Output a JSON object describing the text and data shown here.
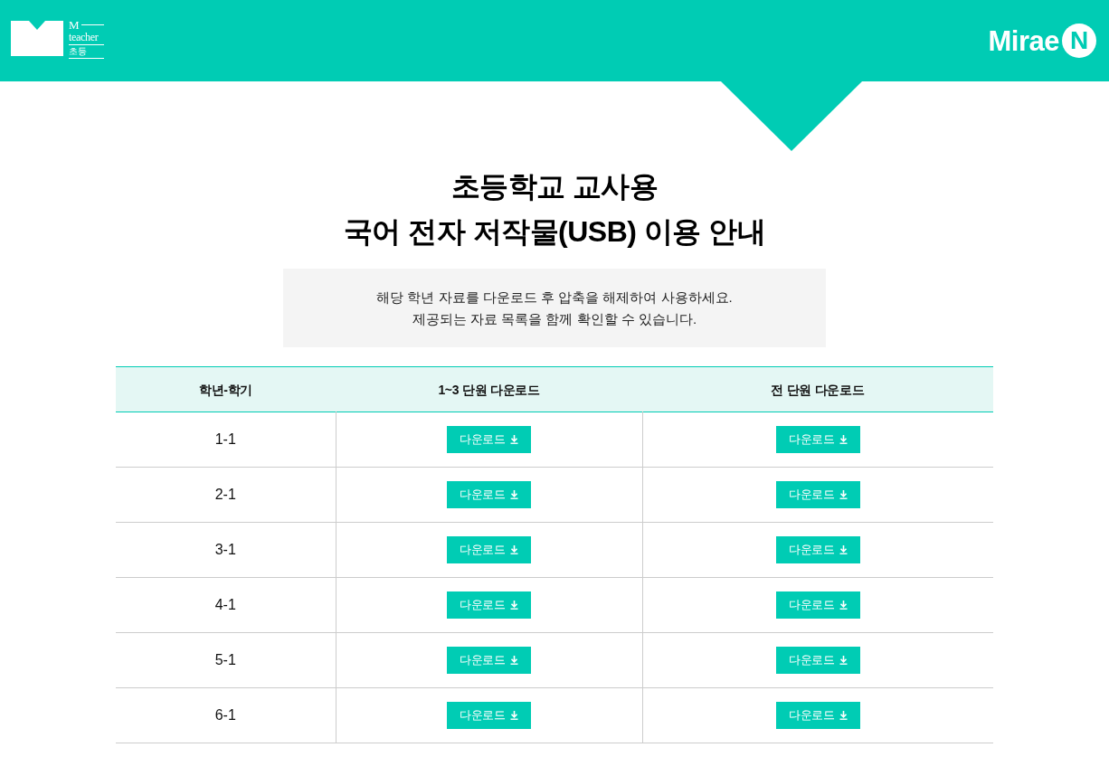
{
  "header": {
    "left_logo": {
      "mark": "M",
      "word": "teacher",
      "section": "초등"
    },
    "right_logo": {
      "word": "Mirae",
      "mark": "N"
    }
  },
  "title": [
    "초등학교 교사용",
    "국어 전자 저작물(USB) 이용 안내"
  ],
  "notice": [
    "해당 학년 자료를 다운로드 후 압축을 해제하여 사용하세요.",
    "제공되는 자료 목록을 함께 확인할 수 있습니다."
  ],
  "table": {
    "columns": [
      "학년-학기",
      "1~3 단원 다운로드",
      "전 단원 다운로드"
    ],
    "rows": [
      {
        "grade": "1-1",
        "downloads": [
          "다운로드",
          "다운로드"
        ]
      },
      {
        "grade": "2-1",
        "downloads": [
          "다운로드",
          "다운로드"
        ]
      },
      {
        "grade": "3-1",
        "downloads": [
          "다운로드",
          "다운로드"
        ]
      },
      {
        "grade": "4-1",
        "downloads": [
          "다운로드",
          "다운로드"
        ]
      },
      {
        "grade": "5-1",
        "downloads": [
          "다운로드",
          "다운로드"
        ]
      },
      {
        "grade": "6-1",
        "downloads": [
          "다운로드",
          "다운로드"
        ]
      }
    ]
  }
}
